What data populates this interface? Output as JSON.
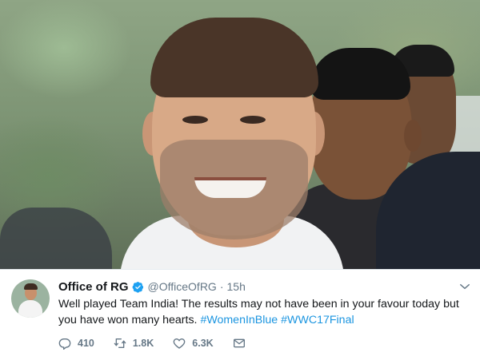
{
  "photo": {
    "description_icon": "photo"
  },
  "tweet": {
    "name": "Office of RG",
    "handle": "@OfficeOfRG",
    "separator": "·",
    "time": "15h",
    "text_part1": "Well played Team India! The results may not have been in your favour today but you have won many hearts. ",
    "hashtag1": "#WomenInBlue",
    "hashtag2": "#WWC17Final",
    "replies": "410",
    "retweets": "1.8K",
    "likes": "6.3K",
    "colors": {
      "hashtag": "#1b95e0",
      "verified": "#1da1f2",
      "muted": "#657786"
    }
  }
}
